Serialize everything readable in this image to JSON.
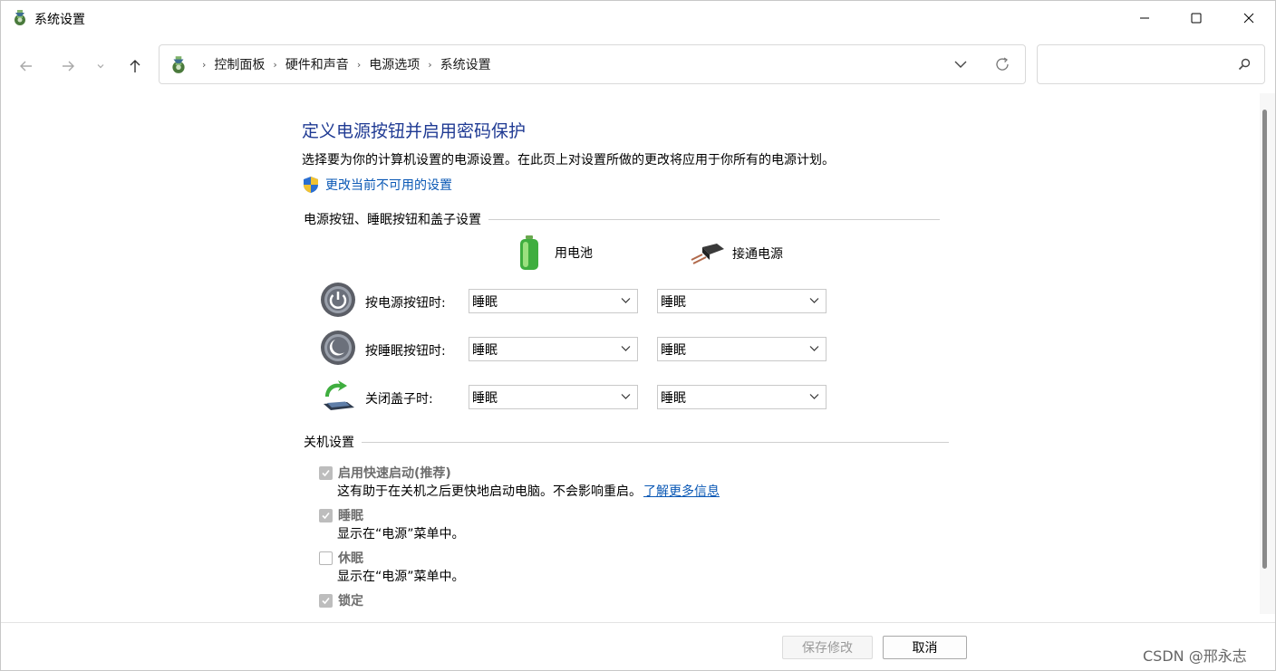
{
  "window": {
    "title": "系统设置"
  },
  "address": {
    "crumbs": [
      "控制面板",
      "硬件和声音",
      "电源选项",
      "系统设置"
    ],
    "separator": "›"
  },
  "search": {
    "placeholder": ""
  },
  "page": {
    "heading": "定义电源按钮并启用密码保护",
    "description": "选择要为你的计算机设置的电源设置。在此页上对设置所做的更改将应用于你所有的电源计划。",
    "change_link": "更改当前不可用的设置"
  },
  "power_section": {
    "title": "电源按钮、睡眠按钮和盖子设置",
    "col_battery": "用电池",
    "col_plugged": "接通电源",
    "rows": [
      {
        "label": "按电源按钮时:",
        "battery": "睡眠",
        "plugged": "睡眠"
      },
      {
        "label": "按睡眠按钮时:",
        "battery": "睡眠",
        "plugged": "睡眠"
      },
      {
        "label": "关闭盖子时:",
        "battery": "睡眠",
        "plugged": "睡眠"
      }
    ]
  },
  "shutdown_section": {
    "title": "关机设置",
    "items": [
      {
        "label": "启用快速启动(推荐)",
        "checked": true,
        "desc": "这有助于在关机之后更快地启动电脑。不会影响重启。",
        "link": "了解更多信息"
      },
      {
        "label": "睡眠",
        "checked": true,
        "desc": "显示在“电源”菜单中。"
      },
      {
        "label": "休眠",
        "checked": false,
        "desc": "显示在“电源”菜单中。"
      },
      {
        "label": "锁定",
        "checked": true,
        "desc": ""
      }
    ]
  },
  "footer": {
    "save_label": "保存修改",
    "cancel_label": "取消"
  },
  "watermark": "CSDN @邢永志",
  "colors": {
    "heading": "#1f3a93",
    "link": "#0a58b5",
    "checkbox_disabled": "#bdbdbd"
  }
}
